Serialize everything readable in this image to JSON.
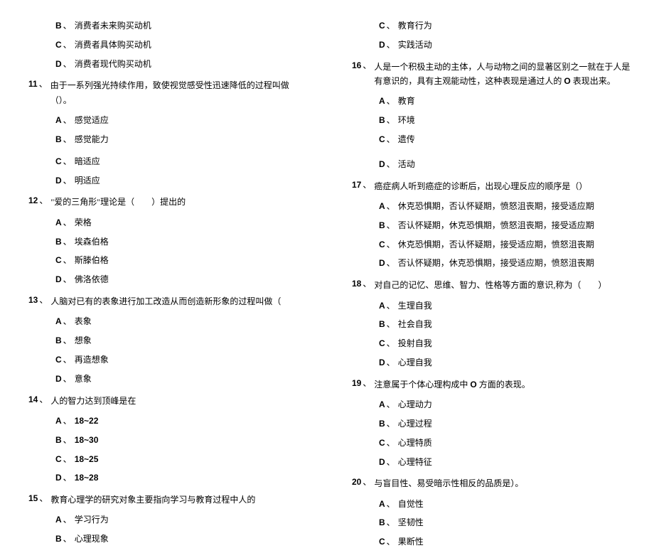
{
  "left": {
    "pre_options": [
      {
        "l": "B",
        "t": "消费者未来购买动机"
      },
      {
        "l": "C",
        "t": "消费者具体购买动机"
      },
      {
        "l": "D",
        "t": "消费者现代购买动机"
      }
    ],
    "q11": {
      "num": "11",
      "text": "由于一系列强光持续作用，致使视觉感受性迅速降低的过程叫做（）。",
      "opts": [
        {
          "l": "A",
          "t": "感觉适应"
        },
        {
          "l": "B",
          "t": "感觉能力"
        },
        {
          "l": "C",
          "t": "暗适应"
        },
        {
          "l": "D",
          "t": "明适应"
        }
      ]
    },
    "q12": {
      "num": "12",
      "text": "\"爱的三角形\"理论是（　　）提出的",
      "opts": [
        {
          "l": "A",
          "t": "荣格"
        },
        {
          "l": "B",
          "t": "埃森伯格"
        },
        {
          "l": "C",
          "t": "斯滕伯格"
        },
        {
          "l": "D",
          "t": "佛洛依德"
        }
      ]
    },
    "q13": {
      "num": "13",
      "text": "人脑对已有的表象进行加工改造从而创造新形象的过程叫做（",
      "opts": [
        {
          "l": "A",
          "t": "表象"
        },
        {
          "l": "B",
          "t": "想象"
        },
        {
          "l": "C",
          "t": "再造想象"
        },
        {
          "l": "D",
          "t": "意象"
        }
      ]
    },
    "q14": {
      "num": "14",
      "text": "人的智力达到顶峰是在",
      "opts": [
        {
          "l": "A",
          "t": "18~22"
        },
        {
          "l": "B",
          "t": "18~30"
        },
        {
          "l": "C",
          "t": "18~25"
        },
        {
          "l": "D",
          "t": "18~28"
        }
      ]
    },
    "q15": {
      "num": "15",
      "text": "教育心理学的研究对象主要指向学习与教育过程中人的",
      "opts": [
        {
          "l": "A",
          "t": "学习行为"
        },
        {
          "l": "B",
          "t": "心理现象"
        }
      ]
    }
  },
  "right": {
    "pre_options": [
      {
        "l": "C",
        "t": "教育行为"
      },
      {
        "l": "D",
        "t": "实践活动"
      }
    ],
    "q16": {
      "num": "16",
      "text_p1": "人是一个积极主动的主体，人与动物之间的显著区别之一就在于人是有意识的，具有主观能动性，这种表现是通过人的",
      "text_p2": "表现出来。",
      "opts": [
        {
          "l": "A",
          "t": "教育"
        },
        {
          "l": "B",
          "t": "环境"
        },
        {
          "l": "C",
          "t": "遗传"
        },
        {
          "l": "D",
          "t": "活动"
        }
      ]
    },
    "q17": {
      "num": "17",
      "text": "癌症病人听到癌症的诊断后，出现心理反应的顺序是（）",
      "opts": [
        {
          "l": "A",
          "t": "休克恐惧期，否认怀疑期，愤怒沮丧期，接受适应期"
        },
        {
          "l": "B",
          "t": "否认怀疑期，休克恐惧期，愤怒沮丧期，接受适应期"
        },
        {
          "l": "C",
          "t": "休克恐惧期，否认怀疑期，接受适应期，愤怒沮丧期"
        },
        {
          "l": "D",
          "t": "否认怀疑期，休克恐惧期，接受适应期，愤怒沮丧期"
        }
      ]
    },
    "q18": {
      "num": "18",
      "text": "对自己的记忆、思维、智力、性格等方面的意识,称为（　　）",
      "opts": [
        {
          "l": "A",
          "t": "生理自我"
        },
        {
          "l": "B",
          "t": "社会自我"
        },
        {
          "l": "C",
          "t": "投射自我"
        },
        {
          "l": "D",
          "t": "心理自我"
        }
      ]
    },
    "q19": {
      "num": "19",
      "text_p1": "注意属于个体心理构成中",
      "text_p2": "方面的表现。",
      "opts": [
        {
          "l": "A",
          "t": "心理动力"
        },
        {
          "l": "B",
          "t": "心理过程"
        },
        {
          "l": "C",
          "t": "心理特质"
        },
        {
          "l": "D",
          "t": "心理特征"
        }
      ]
    },
    "q20": {
      "num": "20",
      "text": "与盲目性、易受暗示性相反的品质是）。",
      "opts": [
        {
          "l": "A",
          "t": "自觉性"
        },
        {
          "l": "B",
          "t": "坚韧性"
        },
        {
          "l": "C",
          "t": "果断性"
        }
      ]
    }
  }
}
